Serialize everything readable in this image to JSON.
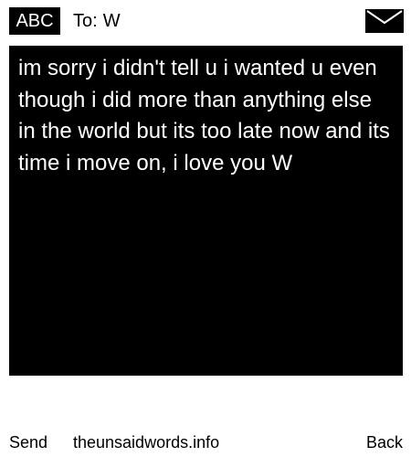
{
  "header": {
    "input_mode": "ABC",
    "to_label": "To:",
    "recipient": "W",
    "envelope_icon": "envelope-icon"
  },
  "message": {
    "body": "im sorry i didn't tell u i wanted u even though i did more than anything else in the world but its too late now and its time i move on, i love you W"
  },
  "footer": {
    "left_softkey": "Send",
    "site": "theunsaidwords.info",
    "right_softkey": "Back"
  },
  "colors": {
    "background": "#ffffff",
    "message_background": "#000000",
    "message_text": "#ffffff",
    "badge_background": "#000000"
  }
}
